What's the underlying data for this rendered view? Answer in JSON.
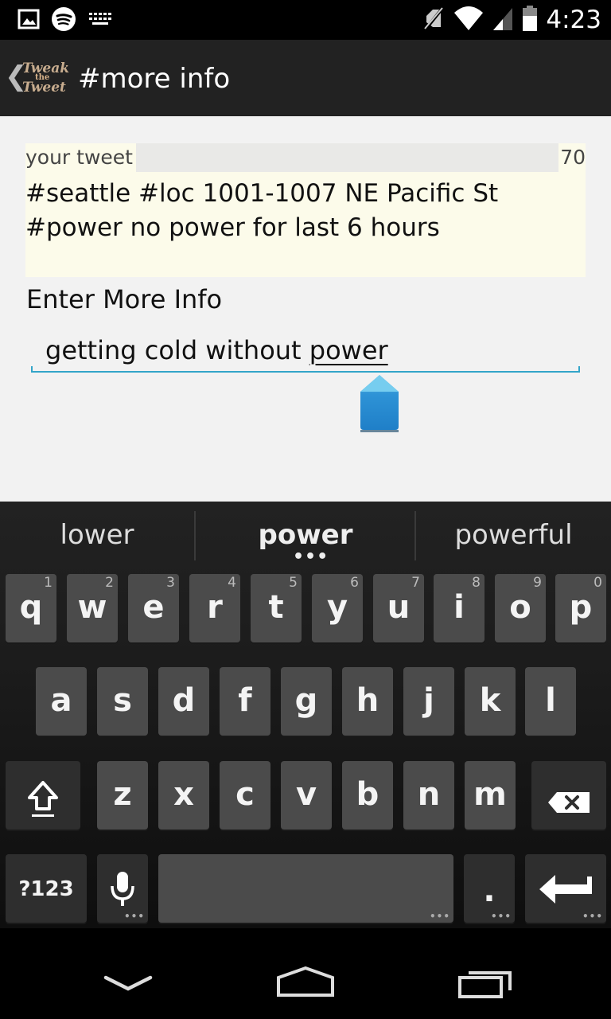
{
  "status_bar": {
    "time": "4:23",
    "left_icons": [
      "image-icon",
      "spotify-icon",
      "keyboard-icon"
    ],
    "right_icons": [
      "mute-icon",
      "wifi-icon",
      "signal-icon",
      "battery-icon"
    ]
  },
  "action_bar": {
    "back_glyph": "❮",
    "logo_text_top": "Tweak",
    "logo_text_mid": "the",
    "logo_text_bottom": "Tweet",
    "title": "#more info"
  },
  "tweet": {
    "label": "your tweet",
    "count": "70",
    "text": "#seattle #loc 1001-1007 NE Pacific St #power no power for last 6 hours"
  },
  "more_info": {
    "label": "Enter More Info",
    "value_prefix": "getting cold without ",
    "value_composing": "power"
  },
  "keyboard": {
    "suggestions": [
      "lower",
      "power",
      "powerful"
    ],
    "suggestion_dots": "•••",
    "row1": [
      {
        "key": "q",
        "alt": "1"
      },
      {
        "key": "w",
        "alt": "2"
      },
      {
        "key": "e",
        "alt": "3"
      },
      {
        "key": "r",
        "alt": "4"
      },
      {
        "key": "t",
        "alt": "5"
      },
      {
        "key": "y",
        "alt": "6"
      },
      {
        "key": "u",
        "alt": "7"
      },
      {
        "key": "i",
        "alt": "8"
      },
      {
        "key": "o",
        "alt": "9"
      },
      {
        "key": "p",
        "alt": "0"
      }
    ],
    "row2": [
      "a",
      "s",
      "d",
      "f",
      "g",
      "h",
      "j",
      "k",
      "l"
    ],
    "row3": [
      "z",
      "x",
      "c",
      "v",
      "b",
      "n",
      "m"
    ],
    "symbols_label": "?123",
    "period_label": ".",
    "more_dots": "•••",
    "accent_color": "#33a5c9"
  },
  "nav_bar": {
    "icons": [
      "back-down-icon",
      "home-icon",
      "recents-icon"
    ]
  }
}
